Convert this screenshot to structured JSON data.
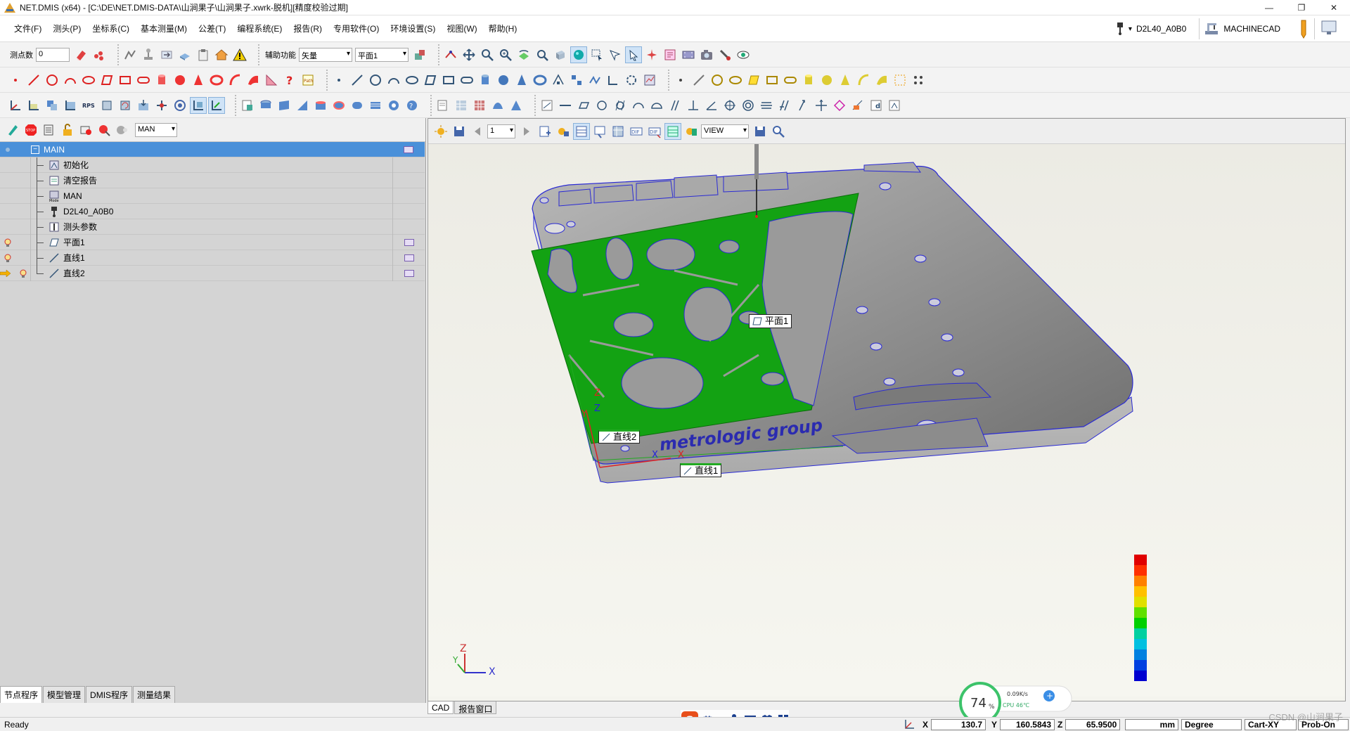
{
  "titlebar": {
    "title": "NET.DMIS (x64) - [C:\\DE\\NET.DMIS-DATA\\山涧果子\\山涧果子.xwrk-脱机][精度校验过期]"
  },
  "menu": {
    "items": [
      "文件(F)",
      "测头(P)",
      "坐标系(C)",
      "基本测量(M)",
      "公差(T)",
      "编程系统(E)",
      "报告(R)",
      "专用软件(O)",
      "环境设置(S)",
      "视图(W)",
      "帮助(H)"
    ],
    "probe_name": "D2L40_A0B0",
    "machine_name": "MACHINECAD"
  },
  "toolbar": {
    "points_label": "测点数",
    "points_value": "0",
    "aux_label": "辅助功能",
    "aux_select": "矢量",
    "plane_select": "平面1"
  },
  "left": {
    "mode_select": "MAN",
    "tree": [
      {
        "label": "MAIN",
        "root": true
      },
      {
        "label": "初始化"
      },
      {
        "label": "清空报告"
      },
      {
        "label": "MAN"
      },
      {
        "label": "D2L40_A0B0"
      },
      {
        "label": "测头参数"
      },
      {
        "label": "平面1"
      },
      {
        "label": "直线1"
      },
      {
        "label": "直线2"
      }
    ],
    "tabs": [
      "节点程序",
      "模型管理",
      "DMIS程序",
      "测量结果"
    ]
  },
  "view": {
    "page_value": "1",
    "view_select": "VIEW",
    "tabs": [
      "CAD",
      "报告窗口"
    ],
    "part_brand": "metrologic group",
    "labels": {
      "plane": "平面1",
      "line1": "直线1",
      "line2": "直线2"
    },
    "axis": {
      "x": "X",
      "y": "Y",
      "z": "Z"
    }
  },
  "status": {
    "ready": "Ready",
    "x_label": "X",
    "x_value": "130.7",
    "y_label": "Y",
    "y_value": "160.5843",
    "z_label": "Z",
    "z_value": "65.9500",
    "unit": "mm",
    "angle": "Degree",
    "cart": "Cart-XY",
    "probe_on": "Prob-On"
  },
  "perf": {
    "percent": "74",
    "net": "0.09K/s",
    "cpu": "CPU 46℃"
  },
  "ime": {
    "lang": "英"
  },
  "watermark": "CSDN @山涧果子",
  "colors": {
    "green": "#13a213",
    "part": "#9a9a9a",
    "edge": "#2a2ad4",
    "tree_root": "#4a90d9"
  }
}
